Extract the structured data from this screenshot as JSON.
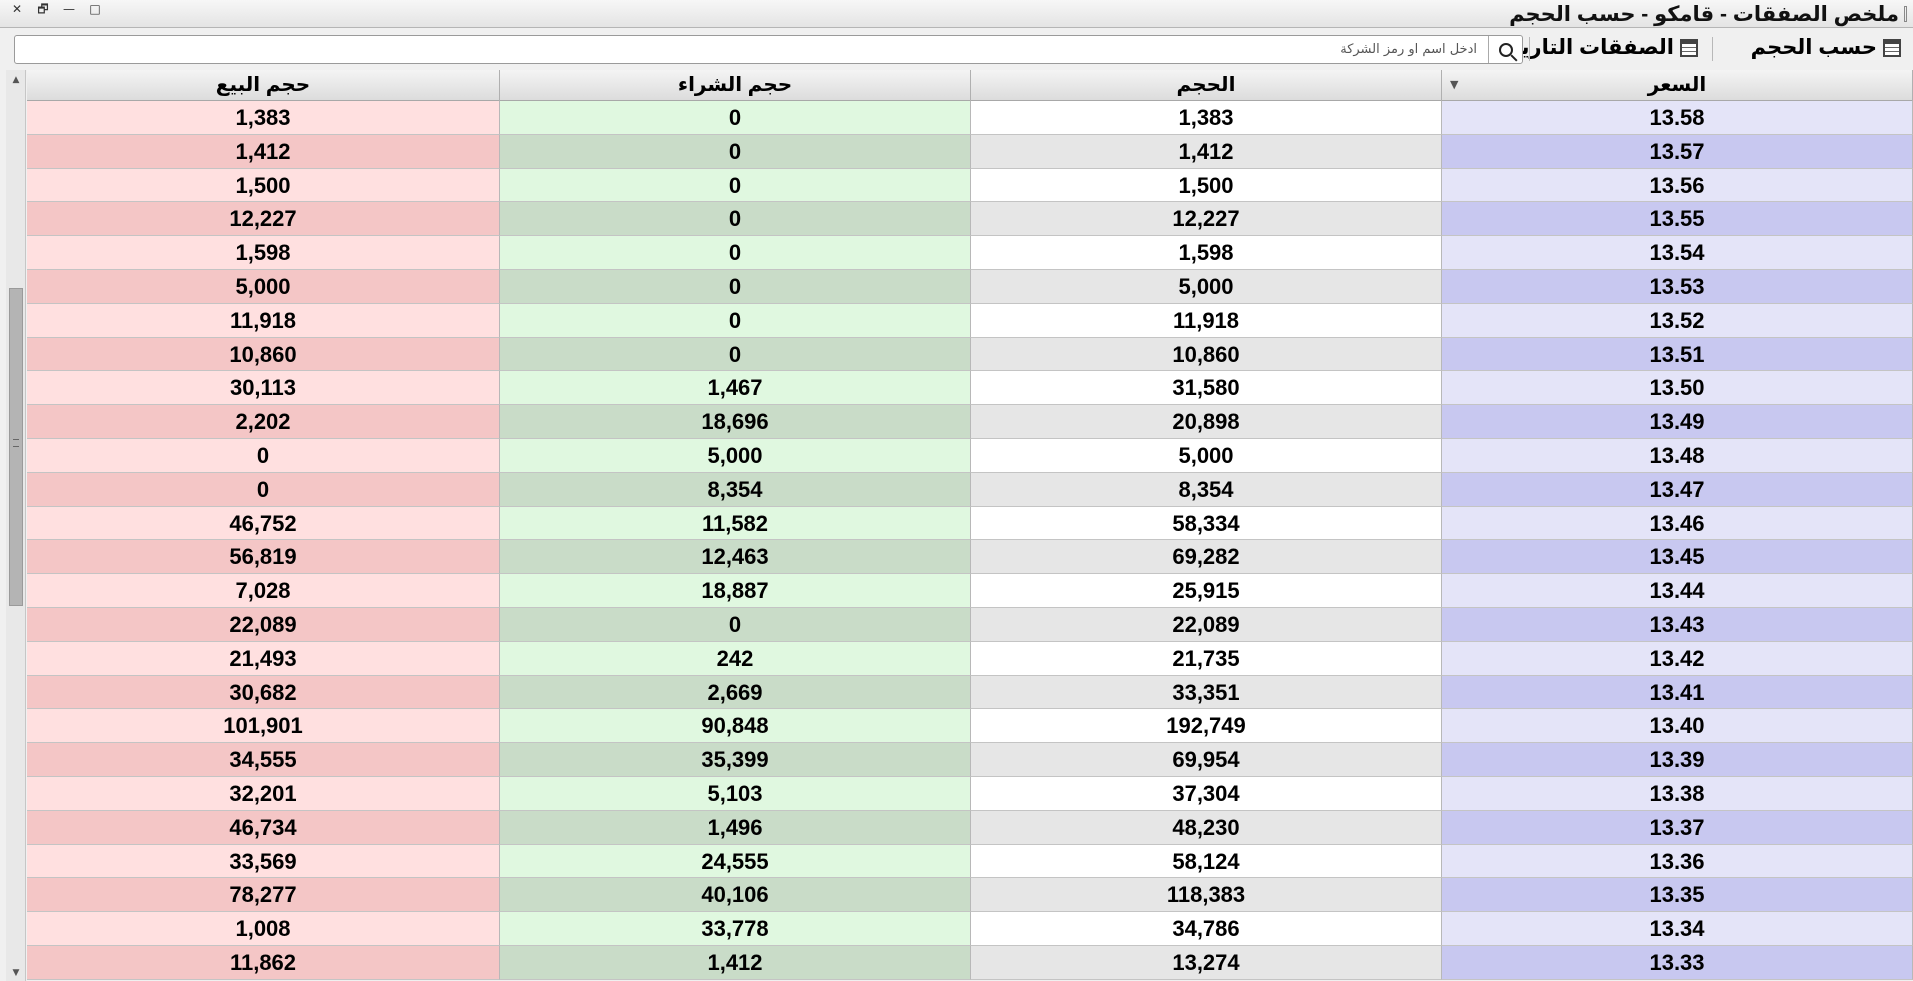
{
  "window": {
    "title": "ملخص الصفقات - قامكو - حسب الحجم",
    "controls": {
      "close": "✕",
      "restore": "🗗",
      "minimize": "—",
      "maximize": "□"
    }
  },
  "toolbar": {
    "by_volume_label": "حسب الحجم",
    "historical_label": "الصفقات التاريخية",
    "search_placeholder": "ادخل اسم او رمز الشركة",
    "search_value": ""
  },
  "table": {
    "columns": {
      "sell_volume": "حجم البيع",
      "buy_volume": "حجم الشراء",
      "volume": "الحجم",
      "price": "السعر"
    },
    "sort_column": "price",
    "rows": [
      {
        "sell": "1,383",
        "buy": "0",
        "volume": "1,383",
        "price": "13.58"
      },
      {
        "sell": "1,412",
        "buy": "0",
        "volume": "1,412",
        "price": "13.57"
      },
      {
        "sell": "1,500",
        "buy": "0",
        "volume": "1,500",
        "price": "13.56"
      },
      {
        "sell": "12,227",
        "buy": "0",
        "volume": "12,227",
        "price": "13.55"
      },
      {
        "sell": "1,598",
        "buy": "0",
        "volume": "1,598",
        "price": "13.54"
      },
      {
        "sell": "5,000",
        "buy": "0",
        "volume": "5,000",
        "price": "13.53"
      },
      {
        "sell": "11,918",
        "buy": "0",
        "volume": "11,918",
        "price": "13.52"
      },
      {
        "sell": "10,860",
        "buy": "0",
        "volume": "10,860",
        "price": "13.51"
      },
      {
        "sell": "30,113",
        "buy": "1,467",
        "volume": "31,580",
        "price": "13.50"
      },
      {
        "sell": "2,202",
        "buy": "18,696",
        "volume": "20,898",
        "price": "13.49"
      },
      {
        "sell": "0",
        "buy": "5,000",
        "volume": "5,000",
        "price": "13.48"
      },
      {
        "sell": "0",
        "buy": "8,354",
        "volume": "8,354",
        "price": "13.47"
      },
      {
        "sell": "46,752",
        "buy": "11,582",
        "volume": "58,334",
        "price": "13.46"
      },
      {
        "sell": "56,819",
        "buy": "12,463",
        "volume": "69,282",
        "price": "13.45"
      },
      {
        "sell": "7,028",
        "buy": "18,887",
        "volume": "25,915",
        "price": "13.44"
      },
      {
        "sell": "22,089",
        "buy": "0",
        "volume": "22,089",
        "price": "13.43"
      },
      {
        "sell": "21,493",
        "buy": "242",
        "volume": "21,735",
        "price": "13.42"
      },
      {
        "sell": "30,682",
        "buy": "2,669",
        "volume": "33,351",
        "price": "13.41"
      },
      {
        "sell": "101,901",
        "buy": "90,848",
        "volume": "192,749",
        "price": "13.40"
      },
      {
        "sell": "34,555",
        "buy": "35,399",
        "volume": "69,954",
        "price": "13.39"
      },
      {
        "sell": "32,201",
        "buy": "5,103",
        "volume": "37,304",
        "price": "13.38"
      },
      {
        "sell": "46,734",
        "buy": "1,496",
        "volume": "48,230",
        "price": "13.37"
      },
      {
        "sell": "33,569",
        "buy": "24,555",
        "volume": "58,124",
        "price": "13.36"
      },
      {
        "sell": "78,277",
        "buy": "40,106",
        "volume": "118,383",
        "price": "13.35"
      },
      {
        "sell": "1,008",
        "buy": "33,778",
        "volume": "34,786",
        "price": "13.34"
      },
      {
        "sell": "11,862",
        "buy": "1,412",
        "volume": "13,274",
        "price": "13.33"
      }
    ]
  },
  "colors": {
    "sell_light": "#ffe0e0",
    "sell_dark": "#f4c6c6",
    "buy_light": "#e0f8e0",
    "buy_dark": "#c9dcc8",
    "price_light": "#e4e4f8",
    "price_dark": "#c8c8f0"
  },
  "icons": {
    "search": "search-icon",
    "calendar": "calendar-icon",
    "sort": "sort-desc-icon"
  }
}
